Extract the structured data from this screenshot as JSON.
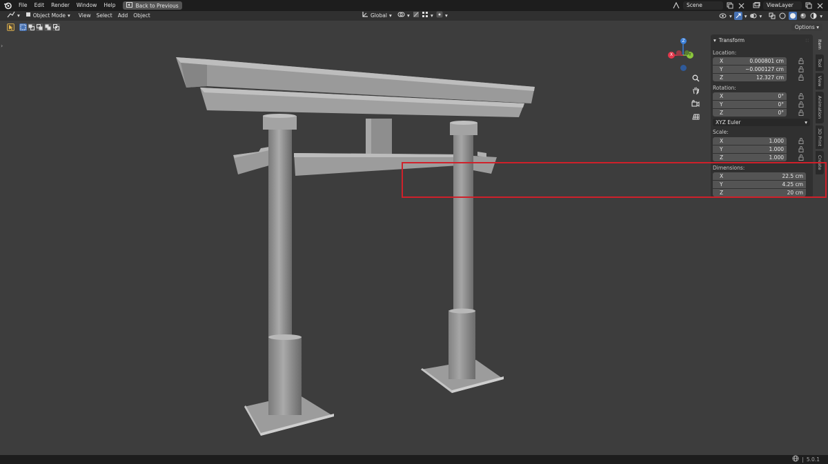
{
  "topbar": {
    "menus": [
      "File",
      "Edit",
      "Render",
      "Window",
      "Help"
    ],
    "back_label": "Back to Previous",
    "scene": "Scene",
    "view_layer": "ViewLayer"
  },
  "header": {
    "mode": "Object Mode",
    "menus": [
      "View",
      "Select",
      "Add",
      "Object"
    ],
    "orientation": "Global"
  },
  "toolrow": {
    "options": "Options"
  },
  "npanel": {
    "title": "Transform",
    "location_label": "Location:",
    "location": [
      {
        "axis": "X",
        "value": "0.000801 cm"
      },
      {
        "axis": "Y",
        "value": "−0.000127 cm"
      },
      {
        "axis": "Z",
        "value": "12.327 cm"
      }
    ],
    "rotation_label": "Rotation:",
    "rotation": [
      {
        "axis": "X",
        "value": "0°"
      },
      {
        "axis": "Y",
        "value": "0°"
      },
      {
        "axis": "Z",
        "value": "0°"
      }
    ],
    "rotation_mode": "XYZ Euler",
    "scale_label": "Scale:",
    "scale": [
      {
        "axis": "X",
        "value": "1.000"
      },
      {
        "axis": "Y",
        "value": "1.000"
      },
      {
        "axis": "Z",
        "value": "1.000"
      }
    ],
    "dimensions_label": "Dimensions:",
    "dimensions": [
      {
        "axis": "X",
        "value": "22.5 cm"
      },
      {
        "axis": "Y",
        "value": "4.25 cm"
      },
      {
        "axis": "Z",
        "value": "20 cm"
      }
    ]
  },
  "sidetabs": [
    "Item",
    "Tool",
    "View",
    "Animation",
    "3D Print",
    "Create"
  ],
  "gizmo": {
    "x": "X",
    "y": "Y",
    "z": "Z"
  },
  "status": {
    "version": "5.0.1"
  },
  "colors": {
    "x_axis": "#e2384c",
    "y_axis": "#8bc73c",
    "z_axis": "#3a7fd9",
    "highlight": "#d0202a",
    "accent": "#4772b3"
  },
  "icons": [
    "blender-logo-icon",
    "back-icon",
    "scene-icon",
    "copy-icon",
    "close-icon",
    "viewlayer-icon",
    "editor-type-icon",
    "object-mode-icon",
    "transform-orientation-icon",
    "snap-icon",
    "proportional-icon",
    "zoom-icon",
    "hand-icon",
    "camera-icon",
    "grid-icon",
    "lock-icon",
    "chevron-down-icon",
    "network-icon"
  ]
}
